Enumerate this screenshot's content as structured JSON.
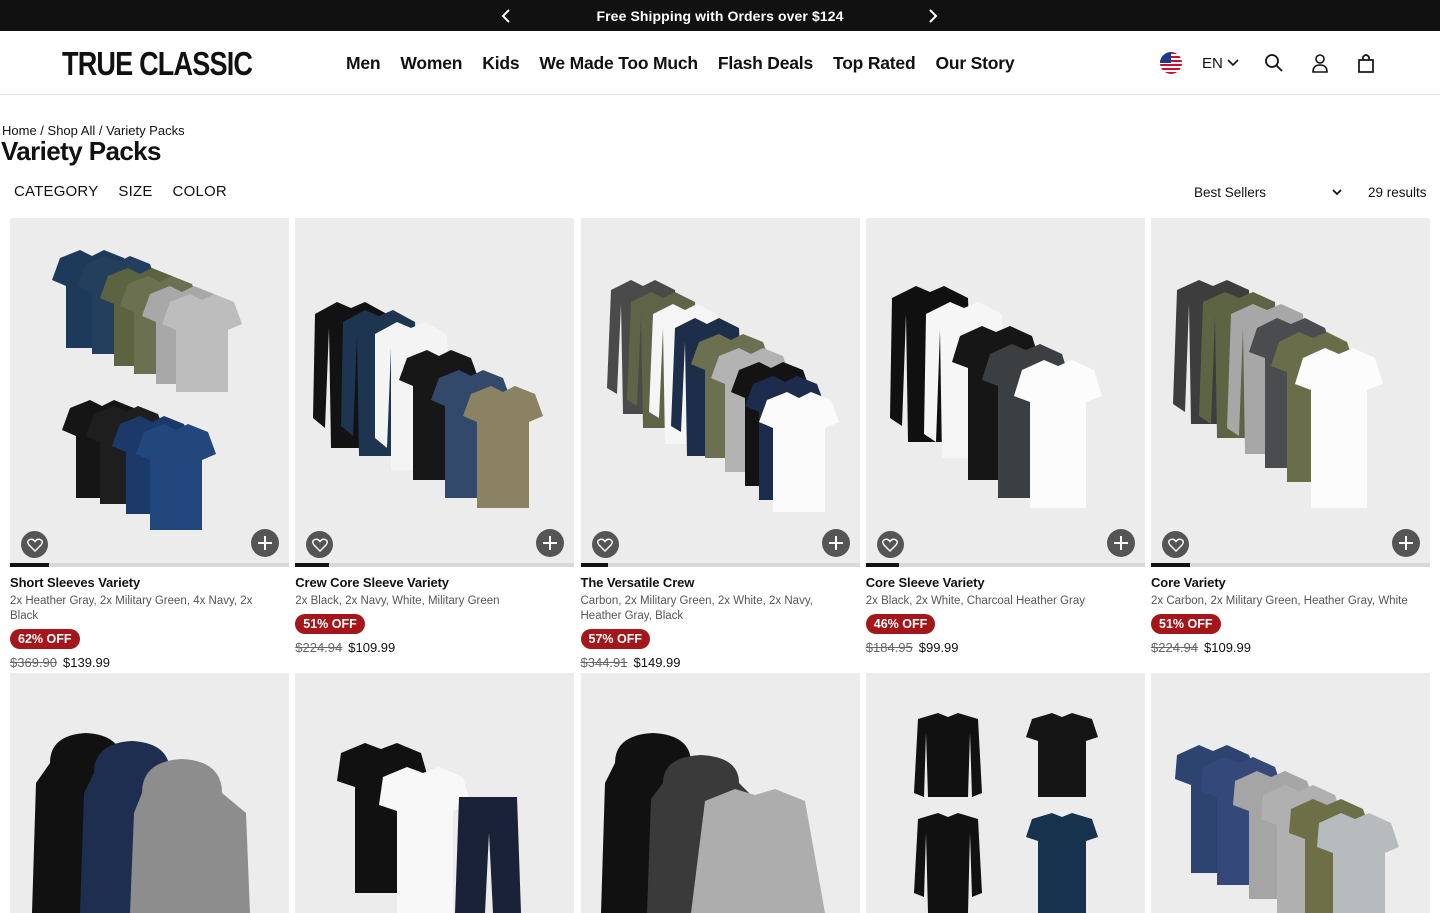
{
  "announcement": {
    "text": "Free Shipping with Orders over $124"
  },
  "header": {
    "logo": "TRUE CLASSIC",
    "nav": [
      "Men",
      "Women",
      "Kids",
      "We Made Too Much",
      "Flash Deals",
      "Top Rated",
      "Our Story"
    ],
    "language": "EN"
  },
  "breadcrumb": {
    "home": "Home",
    "sep1": " / ",
    "shop": "Shop All",
    "sep2": " / ",
    "current": "Variety Packs"
  },
  "page_title": "Variety Packs",
  "filters": [
    "CATEGORY",
    "SIZE",
    "COLOR"
  ],
  "sort": {
    "selected": "Best Sellers"
  },
  "results": "29 results",
  "colors": {
    "badge": "#a4161a",
    "announce_bg": "#111111",
    "image_bg": "#ececec"
  },
  "products": [
    {
      "name": "Short Sleeves Variety",
      "colors": "2x Heather Gray, 2x Military Green, 4x Navy, 2x Black",
      "badge": "62% OFF",
      "old_price": "$369.90",
      "price": "$139.99",
      "progress": 0.14
    },
    {
      "name": "Crew Core Sleeve Variety",
      "colors": "2x Black, 2x Navy, White, Military Green",
      "badge": "51% OFF",
      "old_price": "$224.94",
      "price": "$109.99",
      "progress": 0.12
    },
    {
      "name": "The Versatile Crew",
      "colors": "Carbon, 2x Military Green, 2x White, 2x Navy, Heather Gray, Black",
      "badge": "57% OFF",
      "old_price": "$344.91",
      "price": "$149.99",
      "progress": 0.1
    },
    {
      "name": "Core Sleeve Variety",
      "colors": "2x Black, 2x White, Charcoal Heather Gray",
      "badge": "46% OFF",
      "old_price": "$184.95",
      "price": "$99.99",
      "progress": 0.12
    },
    {
      "name": "Core Variety",
      "colors": "2x Carbon, 2x Military Green, Heather Gray, White",
      "badge": "51% OFF",
      "old_price": "$224.94",
      "price": "$109.99",
      "progress": 0.14
    }
  ]
}
